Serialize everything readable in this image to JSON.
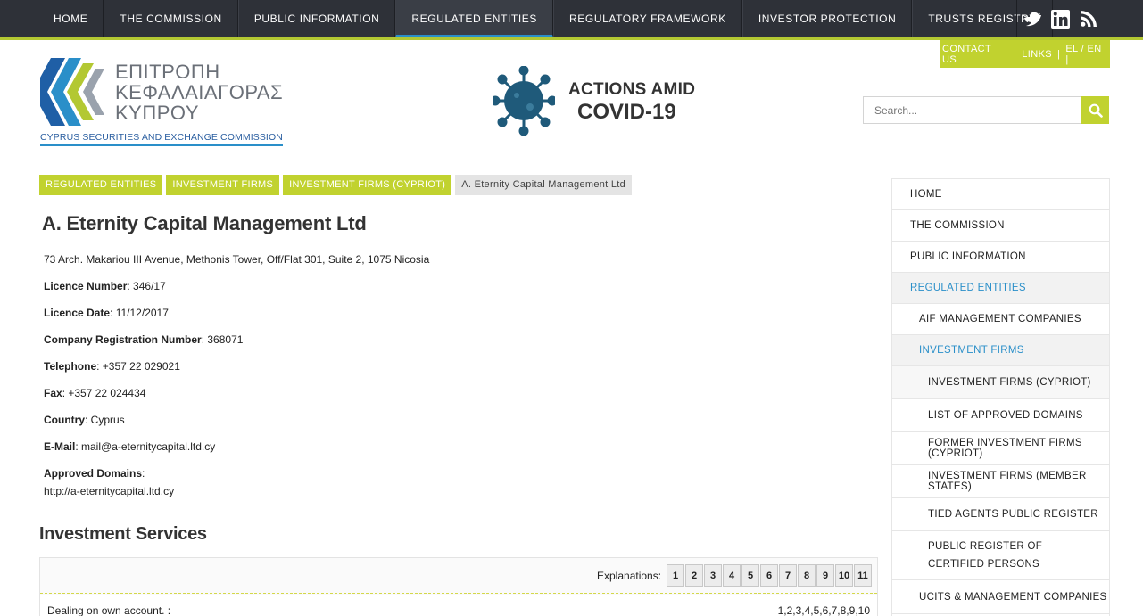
{
  "nav": {
    "items": [
      "HOME",
      "THE COMMISSION",
      "PUBLIC INFORMATION",
      "REGULATED ENTITIES",
      "REGULATORY FRAMEWORK",
      "INVESTOR PROTECTION",
      "TRUSTS REGISTRY"
    ],
    "active_index": 3
  },
  "social": [
    "twitter-icon",
    "linkedin-icon",
    "rss-icon"
  ],
  "contact": {
    "contact_us": "CONTACT US",
    "sep1": "|",
    "links": "LINKS",
    "sep2": "|",
    "lang": "EL / EN |"
  },
  "logo": {
    "line1": "ΕΠΙΤΡΟΠΗ",
    "line2": "ΚΕΦΑΛΑΙΑΓΟΡΑΣ",
    "line3": "ΚΥΠΡΟΥ",
    "subtitle": "CYPRUS SECURITIES AND EXCHANGE COMMISSION"
  },
  "covid": {
    "line1": "ACTIONS AMID",
    "line2": "COVID-19"
  },
  "search": {
    "placeholder": "Search..."
  },
  "breadcrumb": {
    "items": [
      "REGULATED ENTITIES",
      "INVESTMENT FIRMS",
      "INVESTMENT FIRMS (CYPRIOT)"
    ],
    "current": "A. Eternity Capital Management Ltd"
  },
  "entity": {
    "name": "A. Eternity Capital Management Ltd",
    "address": "73 Arch. Makariou III Avenue, Methonis Tower, Off/Flat 301, Suite 2, 1075 Nicosia",
    "fields": [
      {
        "label": "Licence Number",
        "value": ": 346/17"
      },
      {
        "label": "Licence Date",
        "value": ": 11/12/2017"
      },
      {
        "label": "Company Registration Number",
        "value": ": 368071"
      },
      {
        "label": "Telephone",
        "value": ": +357 22 029021"
      },
      {
        "label": "Fax",
        "value": ": +357 22 024434"
      },
      {
        "label": "Country",
        "value": ": Cyprus"
      },
      {
        "label": "E-Mail",
        "value": ": mail@a-eternitycapital.ltd.cy"
      }
    ],
    "domains_label": "Approved Domains",
    "domains_colon": ":",
    "domains_value": "http://a-eternitycapital.ltd.cy"
  },
  "services": {
    "title": "Investment Services",
    "explanations_label": "Explanations:",
    "explanations": [
      "1",
      "2",
      "3",
      "4",
      "5",
      "6",
      "7",
      "8",
      "9",
      "10",
      "11"
    ],
    "rows": [
      {
        "name": "Dealing on own account. :",
        "value": "1,2,3,4,5,6,7,8,9,10"
      }
    ]
  },
  "sidebar": {
    "items": [
      {
        "label": "HOME",
        "level": 0,
        "active": false
      },
      {
        "label": "THE COMMISSION",
        "level": 0,
        "active": false
      },
      {
        "label": "PUBLIC INFORMATION",
        "level": 0,
        "active": false
      },
      {
        "label": "REGULATED ENTITIES",
        "level": 0,
        "active": true
      },
      {
        "label": "AIF MANAGEMENT COMPANIES",
        "level": 1,
        "active": false
      },
      {
        "label": "INVESTMENT FIRMS",
        "level": 1,
        "active": true
      },
      {
        "label": "INVESTMENT FIRMS (CYPRIOT)",
        "level": 2,
        "active": false
      },
      {
        "label": "LIST OF APPROVED DOMAINS",
        "level": 2,
        "active": false
      },
      {
        "label": "FORMER INVESTMENT FIRMS (CYPRIOT)",
        "level": 2,
        "active": false
      },
      {
        "label": "INVESTMENT FIRMS (MEMBER STATES)",
        "level": 2,
        "active": false
      },
      {
        "label": "TIED AGENTS PUBLIC REGISTER",
        "level": 2,
        "active": false
      },
      {
        "label": "PUBLIC REGISTER OF CERTIFIED PERSONS",
        "level": 2,
        "active": false
      },
      {
        "label": "UCITS & MANAGEMENT COMPANIES",
        "level": 1,
        "active": false
      }
    ]
  },
  "colors": {
    "nav_bg": "#2e3138",
    "accent_green": "#c1d22f",
    "accent_blue": "#2a8fc9"
  }
}
